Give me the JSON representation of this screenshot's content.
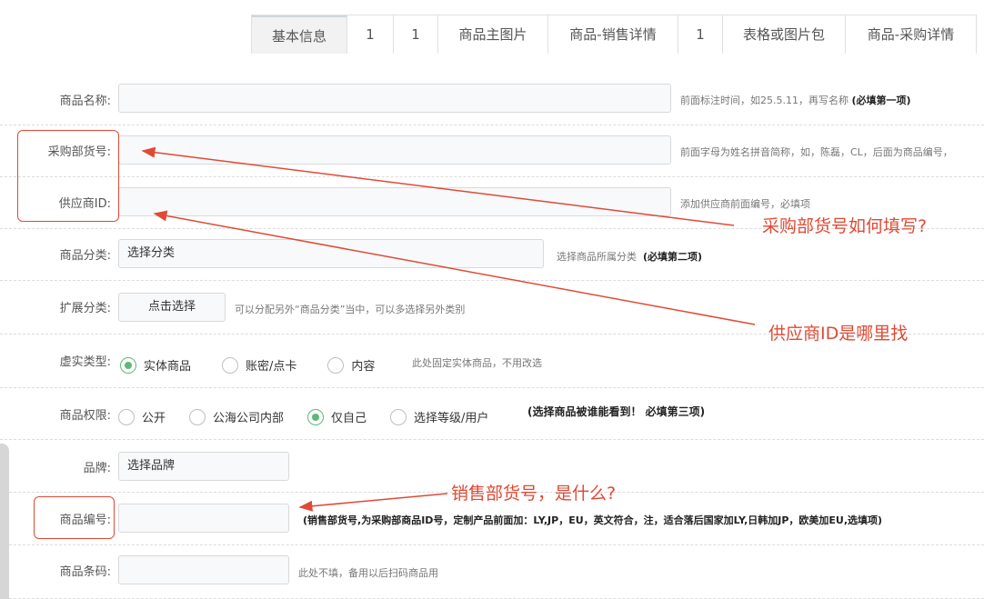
{
  "tabs": [
    {
      "label": "基本信息",
      "active": true
    },
    {
      "label": "1"
    },
    {
      "label": "1"
    },
    {
      "label": "商品主图片"
    },
    {
      "label": "商品-销售详情"
    },
    {
      "label": "1"
    },
    {
      "label": "表格或图片包"
    },
    {
      "label": "商品-采购详情"
    }
  ],
  "form": {
    "name": {
      "label": "商品名称:",
      "value": "",
      "hint": "前面标注时间，如25.5.11，再写名称",
      "hint_bold": "(必填第一项)"
    },
    "purchase_no": {
      "label": "采购部货号:",
      "value": "",
      "hint": "前面字母为姓名拼音简称，如，陈磊，CL，后面为商品编号，"
    },
    "supplier_id": {
      "label": "供应商ID:",
      "value": "",
      "hint": "添加供应商前面编号，必填项"
    },
    "category": {
      "label": "商品分类:",
      "value": "选择分类",
      "hint": "选择商品所属分类",
      "hint_bold": "(必填第二项)"
    },
    "ext_category": {
      "label": "扩展分类:",
      "button": "点击选择",
      "hint": "可以分配另外“商品分类”当中，可以多选择另外类别"
    },
    "virtual_type": {
      "label": "虚实类型:",
      "options": [
        "实体商品",
        "账密/点卡",
        "内容"
      ],
      "selected": 0,
      "hint": "此处固定实体商品，不用改选"
    },
    "permission": {
      "label": "商品权限:",
      "options": [
        "公开",
        "公海公司内部",
        "仅自己",
        "选择等级/用户"
      ],
      "selected": 2,
      "note": "(选择商品被谁能看到！ 必填第三项)"
    },
    "brand": {
      "label": "品牌:",
      "value": "选择品牌"
    },
    "product_no": {
      "label": "商品编号:",
      "value": "",
      "note": "(销售部货号,为采购部商品ID号，定制产品前面加：LY,JP，EU，英文符合，注，适合落后国家加LY,日韩加JP，欧美加EU,选填项)"
    },
    "barcode": {
      "label": "商品条码:",
      "value": "",
      "hint": "此处不填，备用以后扫码商品用"
    }
  },
  "annotations": {
    "q1": "采购部货号如何填写?",
    "q2": "供应商ID是哪里找",
    "q3": "销售部货号，是什么?",
    "color": "#e04a35"
  }
}
